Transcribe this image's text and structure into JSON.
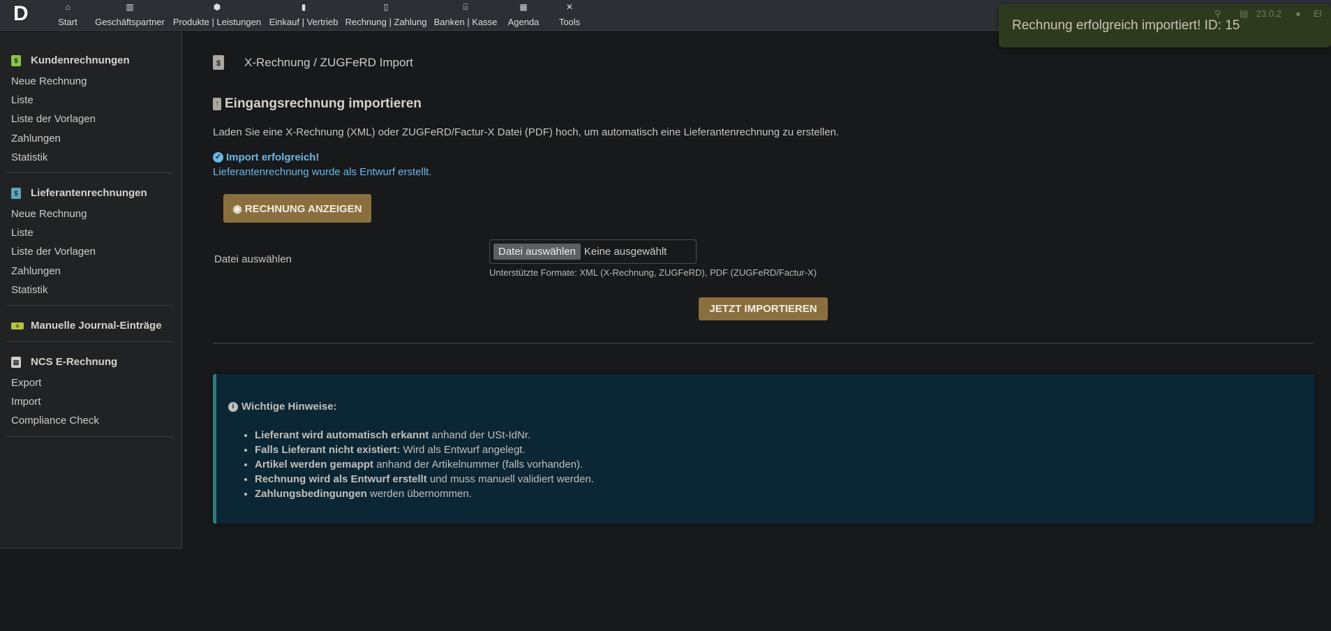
{
  "nav": {
    "logo": "D",
    "items": [
      {
        "label": "Start",
        "icon": "home-icon",
        "glyph": "⌂"
      },
      {
        "label": "Geschäftspartner",
        "icon": "building-icon",
        "glyph": "▥"
      },
      {
        "label": "Produkte | Leistungen",
        "icon": "box-icon",
        "glyph": "⬢"
      },
      {
        "label": "Einkauf | Vertrieb",
        "icon": "briefcase-icon",
        "glyph": "▮"
      },
      {
        "label": "Rechnung | Zahlung",
        "icon": "invoice-icon",
        "glyph": "▯"
      },
      {
        "label": "Banken | Kasse",
        "icon": "bank-icon",
        "glyph": "⌸"
      },
      {
        "label": "Agenda",
        "icon": "calendar-icon",
        "glyph": "▦"
      },
      {
        "label": "Tools",
        "icon": "tools-icon",
        "glyph": "✕"
      }
    ],
    "version": "23.0.2",
    "user": "El"
  },
  "toast": "Rechnung erfolgreich importiert! ID: 15",
  "sidebar": {
    "sections": [
      {
        "title": "Kundenrechnungen",
        "color": "#8bc34a",
        "items": [
          "Neue Rechnung",
          "Liste",
          "Liste der Vorlagen",
          "Zahlungen",
          "Statistik"
        ]
      },
      {
        "title": "Lieferantenrechnungen",
        "color": "#5aa5c0",
        "items": [
          "Neue Rechnung",
          "Liste",
          "Liste der Vorlagen",
          "Zahlungen",
          "Statistik"
        ]
      },
      {
        "title": "Manuelle Journal-Einträge",
        "color": "#b8c43a",
        "items": []
      },
      {
        "title": "NCS E-Rechnung",
        "color": "#d0cdc7",
        "items": [
          "Export",
          "Import",
          "Compliance Check"
        ]
      }
    ]
  },
  "main": {
    "title": "X-Rechnung / ZUGFeRD Import",
    "heading": "Eingangsrechnung importieren",
    "description": "Laden Sie eine X-Rechnung (XML) oder ZUGFeRD/Factur-X Datei (PDF) hoch, um automatisch eine Lieferantenrechnung zu erstellen.",
    "success_title": "Import erfolgreich!",
    "success_text": "Lieferantenrechnung wurde als Entwurf erstellt.",
    "view_button": "Rechnung anzeigen",
    "file_label": "Datei auswählen",
    "file_button": "Datei auswählen",
    "file_status": "Keine ausgewählt",
    "file_help": "Unterstützte Formate: XML (X-Rechnung, ZUGFeRD), PDF (ZUGFeRD/Factur-X)",
    "import_button": "Jetzt importieren",
    "info": {
      "title": "Wichtige Hinweise:",
      "items": [
        {
          "bold": "Lieferant wird automatisch erkannt",
          "text": " anhand der USt-IdNr."
        },
        {
          "bold": "Falls Lieferant nicht existiert:",
          "text": " Wird als Entwurf angelegt."
        },
        {
          "bold": "Artikel werden gemappt",
          "text": " anhand der Artikelnummer (falls vorhanden)."
        },
        {
          "bold": "Rechnung wird als Entwurf erstellt",
          "text": " und muss manuell validiert werden."
        },
        {
          "bold": "Zahlungsbedingungen",
          "text": " werden übernommen."
        }
      ]
    }
  }
}
